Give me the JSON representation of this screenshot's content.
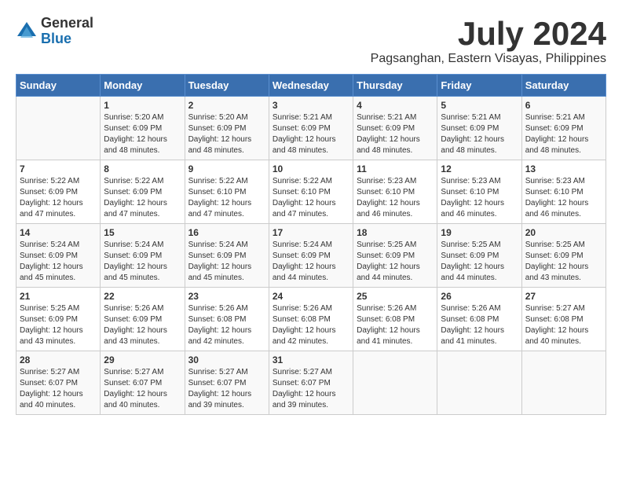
{
  "logo": {
    "general": "General",
    "blue": "Blue"
  },
  "title": "July 2024",
  "subtitle": "Pagsanghan, Eastern Visayas, Philippines",
  "header_days": [
    "Sunday",
    "Monday",
    "Tuesday",
    "Wednesday",
    "Thursday",
    "Friday",
    "Saturday"
  ],
  "weeks": [
    [
      {
        "day": "",
        "info": ""
      },
      {
        "day": "1",
        "info": "Sunrise: 5:20 AM\nSunset: 6:09 PM\nDaylight: 12 hours and 48 minutes."
      },
      {
        "day": "2",
        "info": "Sunrise: 5:20 AM\nSunset: 6:09 PM\nDaylight: 12 hours and 48 minutes."
      },
      {
        "day": "3",
        "info": "Sunrise: 5:21 AM\nSunset: 6:09 PM\nDaylight: 12 hours and 48 minutes."
      },
      {
        "day": "4",
        "info": "Sunrise: 5:21 AM\nSunset: 6:09 PM\nDaylight: 12 hours and 48 minutes."
      },
      {
        "day": "5",
        "info": "Sunrise: 5:21 AM\nSunset: 6:09 PM\nDaylight: 12 hours and 48 minutes."
      },
      {
        "day": "6",
        "info": "Sunrise: 5:21 AM\nSunset: 6:09 PM\nDaylight: 12 hours and 48 minutes."
      }
    ],
    [
      {
        "day": "7",
        "info": "Sunrise: 5:22 AM\nSunset: 6:09 PM\nDaylight: 12 hours and 47 minutes."
      },
      {
        "day": "8",
        "info": "Sunrise: 5:22 AM\nSunset: 6:09 PM\nDaylight: 12 hours and 47 minutes."
      },
      {
        "day": "9",
        "info": "Sunrise: 5:22 AM\nSunset: 6:10 PM\nDaylight: 12 hours and 47 minutes."
      },
      {
        "day": "10",
        "info": "Sunrise: 5:22 AM\nSunset: 6:10 PM\nDaylight: 12 hours and 47 minutes."
      },
      {
        "day": "11",
        "info": "Sunrise: 5:23 AM\nSunset: 6:10 PM\nDaylight: 12 hours and 46 minutes."
      },
      {
        "day": "12",
        "info": "Sunrise: 5:23 AM\nSunset: 6:10 PM\nDaylight: 12 hours and 46 minutes."
      },
      {
        "day": "13",
        "info": "Sunrise: 5:23 AM\nSunset: 6:10 PM\nDaylight: 12 hours and 46 minutes."
      }
    ],
    [
      {
        "day": "14",
        "info": "Sunrise: 5:24 AM\nSunset: 6:09 PM\nDaylight: 12 hours and 45 minutes."
      },
      {
        "day": "15",
        "info": "Sunrise: 5:24 AM\nSunset: 6:09 PM\nDaylight: 12 hours and 45 minutes."
      },
      {
        "day": "16",
        "info": "Sunrise: 5:24 AM\nSunset: 6:09 PM\nDaylight: 12 hours and 45 minutes."
      },
      {
        "day": "17",
        "info": "Sunrise: 5:24 AM\nSunset: 6:09 PM\nDaylight: 12 hours and 44 minutes."
      },
      {
        "day": "18",
        "info": "Sunrise: 5:25 AM\nSunset: 6:09 PM\nDaylight: 12 hours and 44 minutes."
      },
      {
        "day": "19",
        "info": "Sunrise: 5:25 AM\nSunset: 6:09 PM\nDaylight: 12 hours and 44 minutes."
      },
      {
        "day": "20",
        "info": "Sunrise: 5:25 AM\nSunset: 6:09 PM\nDaylight: 12 hours and 43 minutes."
      }
    ],
    [
      {
        "day": "21",
        "info": "Sunrise: 5:25 AM\nSunset: 6:09 PM\nDaylight: 12 hours and 43 minutes."
      },
      {
        "day": "22",
        "info": "Sunrise: 5:26 AM\nSunset: 6:09 PM\nDaylight: 12 hours and 43 minutes."
      },
      {
        "day": "23",
        "info": "Sunrise: 5:26 AM\nSunset: 6:08 PM\nDaylight: 12 hours and 42 minutes."
      },
      {
        "day": "24",
        "info": "Sunrise: 5:26 AM\nSunset: 6:08 PM\nDaylight: 12 hours and 42 minutes."
      },
      {
        "day": "25",
        "info": "Sunrise: 5:26 AM\nSunset: 6:08 PM\nDaylight: 12 hours and 41 minutes."
      },
      {
        "day": "26",
        "info": "Sunrise: 5:26 AM\nSunset: 6:08 PM\nDaylight: 12 hours and 41 minutes."
      },
      {
        "day": "27",
        "info": "Sunrise: 5:27 AM\nSunset: 6:08 PM\nDaylight: 12 hours and 40 minutes."
      }
    ],
    [
      {
        "day": "28",
        "info": "Sunrise: 5:27 AM\nSunset: 6:07 PM\nDaylight: 12 hours and 40 minutes."
      },
      {
        "day": "29",
        "info": "Sunrise: 5:27 AM\nSunset: 6:07 PM\nDaylight: 12 hours and 40 minutes."
      },
      {
        "day": "30",
        "info": "Sunrise: 5:27 AM\nSunset: 6:07 PM\nDaylight: 12 hours and 39 minutes."
      },
      {
        "day": "31",
        "info": "Sunrise: 5:27 AM\nSunset: 6:07 PM\nDaylight: 12 hours and 39 minutes."
      },
      {
        "day": "",
        "info": ""
      },
      {
        "day": "",
        "info": ""
      },
      {
        "day": "",
        "info": ""
      }
    ]
  ]
}
